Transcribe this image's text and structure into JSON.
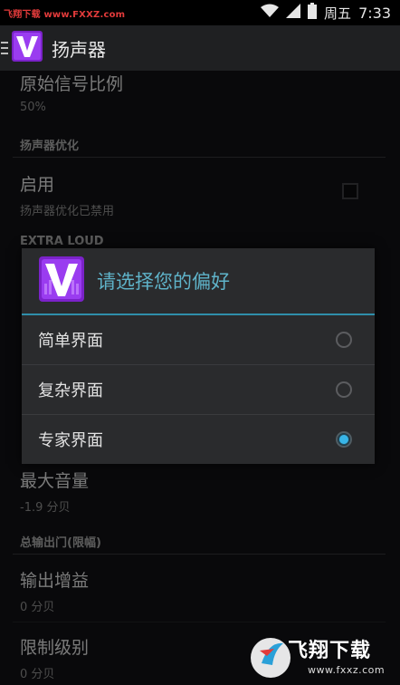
{
  "status_bar": {
    "watermark": "飞翔下载 www.FXXZ.com",
    "day": "周五",
    "time": "7:33",
    "icons": [
      "wifi-icon",
      "signal-icon",
      "battery-icon"
    ]
  },
  "action_bar": {
    "title": "扬声器",
    "icons": [
      "menu-icon",
      "app-logo-icon"
    ]
  },
  "settings": {
    "original_ratio": {
      "title": "原始信号比例",
      "value": "50%"
    },
    "section_speaker_opt": "扬声器优化",
    "enable": {
      "title": "启用",
      "summary": "扬声器优化已禁用",
      "checked": false
    },
    "section_extra_loud": "EXTRA LOUD",
    "max_volume": {
      "title": "最大音量",
      "value": "-1.9 分贝"
    },
    "section_output": "总输出门(限幅)",
    "output_gain": {
      "title": "输出增益",
      "value": "0 分贝"
    },
    "limit_level": {
      "title": "限制级别",
      "value": "0 分贝"
    }
  },
  "dialog": {
    "title": "请选择您的偏好",
    "options": [
      {
        "label": "简单界面",
        "selected": false
      },
      {
        "label": "复杂界面",
        "selected": false
      },
      {
        "label": "专家界面",
        "selected": true
      }
    ]
  },
  "site_watermark": {
    "name": "飞翔下载",
    "url": "www.fxxz.com"
  },
  "colors": {
    "accent": "#38b6e8",
    "dialog_title": "#5fb3c9",
    "logo_purple": "#8a2be2",
    "background": "#111214"
  }
}
